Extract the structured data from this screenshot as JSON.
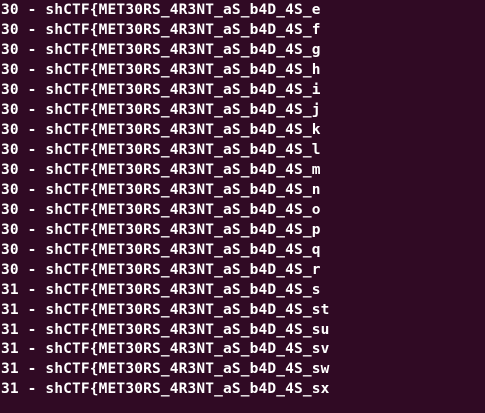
{
  "terminal": {
    "background_color": "#300a24",
    "text_color": "#ffffff",
    "lines": [
      "30 - shCTF{MET30RS_4R3NT_aS_b4D_4S_e",
      "30 - shCTF{MET30RS_4R3NT_aS_b4D_4S_f",
      "30 - shCTF{MET30RS_4R3NT_aS_b4D_4S_g",
      "30 - shCTF{MET30RS_4R3NT_aS_b4D_4S_h",
      "30 - shCTF{MET30RS_4R3NT_aS_b4D_4S_i",
      "30 - shCTF{MET30RS_4R3NT_aS_b4D_4S_j",
      "30 - shCTF{MET30RS_4R3NT_aS_b4D_4S_k",
      "30 - shCTF{MET30RS_4R3NT_aS_b4D_4S_l",
      "30 - shCTF{MET30RS_4R3NT_aS_b4D_4S_m",
      "30 - shCTF{MET30RS_4R3NT_aS_b4D_4S_n",
      "30 - shCTF{MET30RS_4R3NT_aS_b4D_4S_o",
      "30 - shCTF{MET30RS_4R3NT_aS_b4D_4S_p",
      "30 - shCTF{MET30RS_4R3NT_aS_b4D_4S_q",
      "30 - shCTF{MET30RS_4R3NT_aS_b4D_4S_r",
      "31 - shCTF{MET30RS_4R3NT_aS_b4D_4S_s",
      "31 - shCTF{MET30RS_4R3NT_aS_b4D_4S_st",
      "31 - shCTF{MET30RS_4R3NT_aS_b4D_4S_su",
      "31 - shCTF{MET30RS_4R3NT_aS_b4D_4S_sv",
      "31 - shCTF{MET30RS_4R3NT_aS_b4D_4S_sw",
      "31 - shCTF{MET30RS_4R3NT_aS_b4D_4S_sx"
    ]
  }
}
